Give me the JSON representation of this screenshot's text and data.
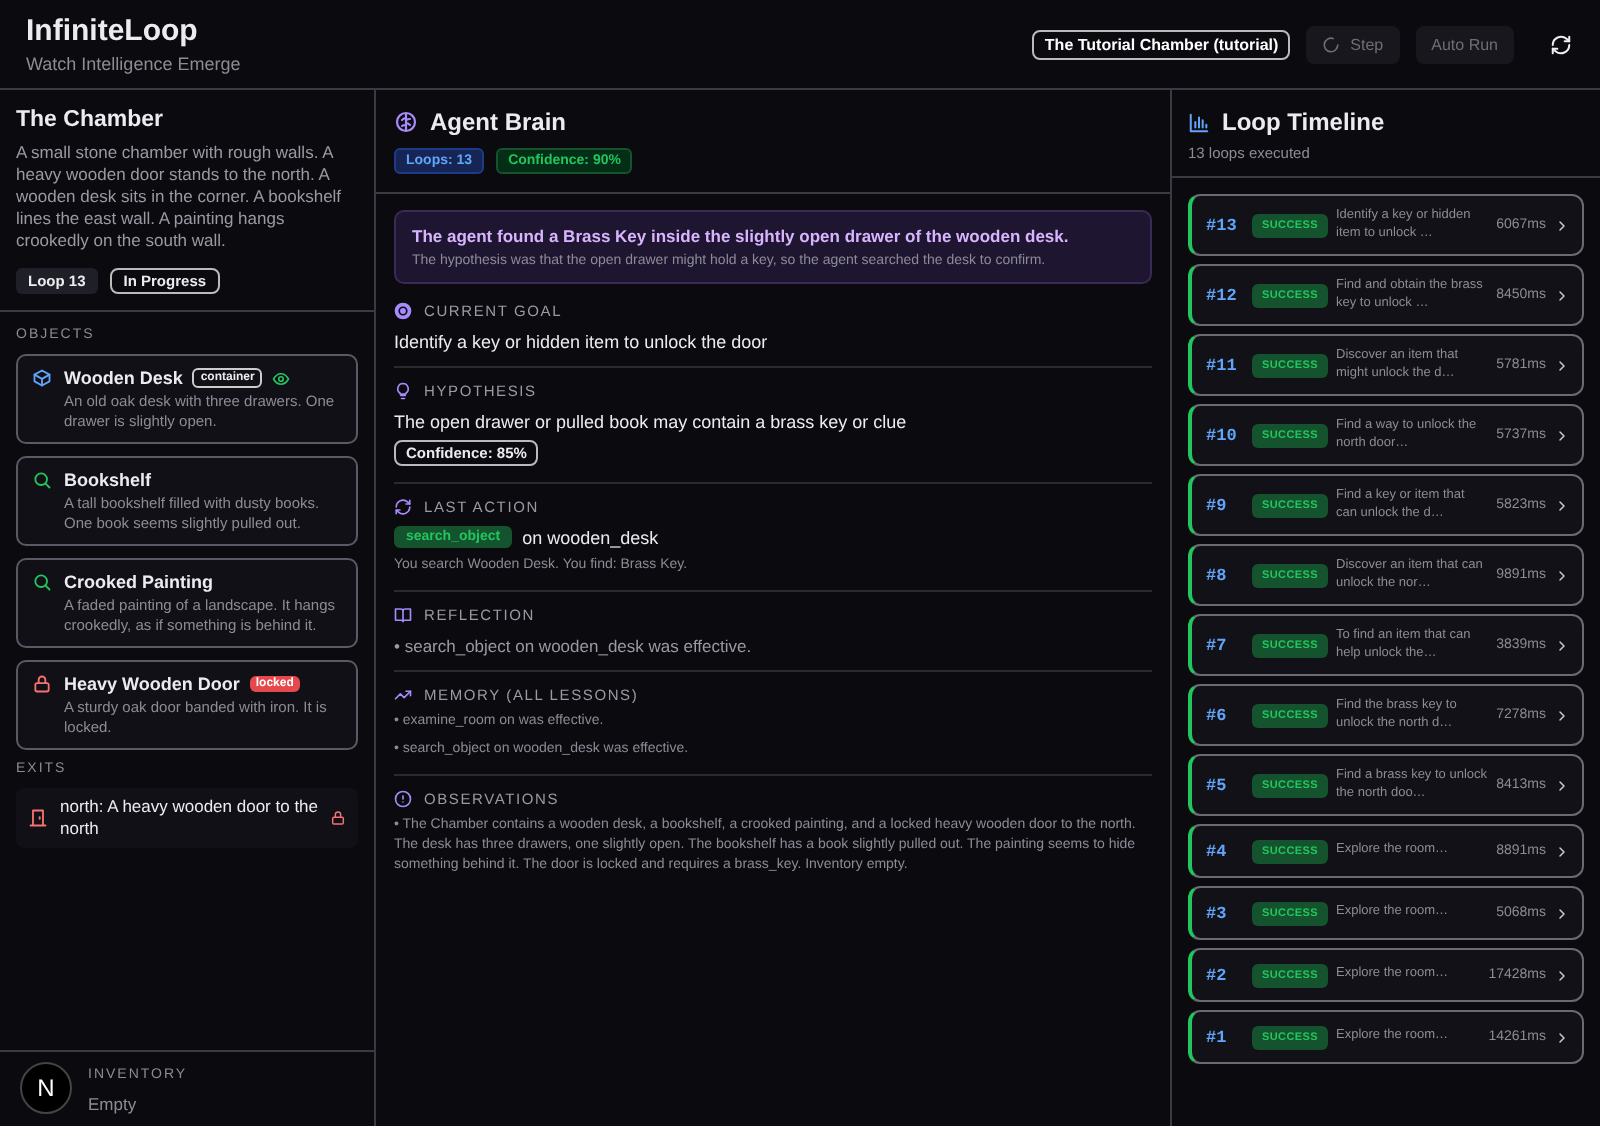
{
  "app": {
    "title": "InfiniteLoop",
    "subtitle": "Watch Intelligence Emerge"
  },
  "toolbar": {
    "scenario": "The Tutorial Chamber (tutorial)",
    "buttons": [
      {
        "kind": "spinner",
        "label": "Step",
        "disabled": true
      },
      {
        "kind": "plain",
        "label": "Auto Run",
        "disabled": true
      },
      {
        "kind": "refresh",
        "disabled": false
      }
    ]
  },
  "chamber": {
    "title": "The Chamber",
    "description": "A small stone chamber with rough walls. A heavy wooden door stands to the north. A wooden desk sits in the corner. A bookshelf lines the east wall. A painting hangs crookedly on the south wall.",
    "loop": "Loop 13",
    "status": "In Progress",
    "objects_heading": "OBJECTS",
    "objects": [
      {
        "kind": "container",
        "name": "Wooden Desk",
        "tag": {
          "text": "container",
          "kind": "outline"
        },
        "examined": true,
        "description": "An old oak desk with three drawers. One drawer is slightly open."
      },
      {
        "kind": "searchable",
        "name": "Bookshelf",
        "examined": false,
        "description": "A tall bookshelf filled with dusty books. One book seems slightly pulled out."
      },
      {
        "kind": "searchable",
        "name": "Crooked Painting",
        "examined": false,
        "description": "A faded painting of a landscape. It hangs crookedly, as if something is behind it."
      },
      {
        "kind": "locked",
        "name": "Heavy Wooden Door",
        "tag": {
          "text": "locked",
          "kind": "danger"
        },
        "examined": false,
        "description": "A sturdy oak door banded with iron. It is locked."
      }
    ],
    "exits_heading": "EXITS",
    "exits": [
      {
        "label": "north: A heavy wooden door to the north",
        "locked": true
      }
    ],
    "inventory": {
      "heading": "INVENTORY",
      "value": "Empty"
    }
  },
  "brain": {
    "title": "Agent Brain",
    "loops": "Loops: 13",
    "confidence": "Confidence: 90%",
    "insight": {
      "headline": "The agent found a Brass Key inside the slightly open drawer of the wooden desk.",
      "detail": "The hypothesis was that the open drawer might hold a key, so the agent searched the desk to confirm."
    },
    "sections": [
      {
        "kind": "goal",
        "heading": "CURRENT GOAL",
        "text": "Identify a key or hidden item to unlock the door"
      },
      {
        "kind": "hypothesis",
        "heading": "HYPOTHESIS",
        "text": "The open drawer or pulled book may contain a brass key or clue",
        "badge": "Confidence: 85%"
      },
      {
        "kind": "action",
        "heading": "LAST ACTION",
        "action": "search_object",
        "target": "on wooden_desk",
        "result": "You search Wooden Desk. You find: Brass Key."
      },
      {
        "kind": "reflection",
        "heading": "REFLECTION",
        "lines": [
          "• search_object on wooden_desk was effective."
        ]
      },
      {
        "kind": "memory",
        "heading": "MEMORY (ALL LESSONS)",
        "lines": [
          "• examine_room on was effective.",
          "• search_object on wooden_desk was effective."
        ]
      },
      {
        "kind": "observations",
        "heading": "OBSERVATIONS",
        "lines": [
          "• The Chamber contains a wooden desk, a bookshelf, a crooked painting, and a locked heavy wooden door to the north. The desk has three drawers, one slightly open. The bookshelf has a book slightly pulled out. The painting seems to hide something behind it. The door is locked and requires a brass_key. Inventory empty."
        ]
      }
    ]
  },
  "timeline": {
    "title": "Loop Timeline",
    "subtitle": "13 loops executed",
    "loops": [
      {
        "kind": "success",
        "number": "#13",
        "status": "SUCCESS",
        "goal": "Identify a key or hidden item to unlock …",
        "duration": "6067ms"
      },
      {
        "kind": "success",
        "number": "#12",
        "status": "SUCCESS",
        "goal": "Find and obtain the brass key to unlock …",
        "duration": "8450ms"
      },
      {
        "kind": "success",
        "number": "#11",
        "status": "SUCCESS",
        "goal": "Discover an item that might unlock the d…",
        "duration": "5781ms"
      },
      {
        "kind": "success",
        "number": "#10",
        "status": "SUCCESS",
        "goal": "Find a way to unlock the north door…",
        "duration": "5737ms"
      },
      {
        "kind": "success",
        "number": "#9",
        "status": "SUCCESS",
        "goal": "Find a key or item that can unlock the d…",
        "duration": "5823ms"
      },
      {
        "kind": "success",
        "number": "#8",
        "status": "SUCCESS",
        "goal": "Discover an item that can unlock the nor…",
        "duration": "9891ms"
      },
      {
        "kind": "success",
        "number": "#7",
        "status": "SUCCESS",
        "goal": "To find an item that can help unlock the…",
        "duration": "3839ms"
      },
      {
        "kind": "success",
        "number": "#6",
        "status": "SUCCESS",
        "goal": "Find the brass key to unlock the north d…",
        "duration": "7278ms"
      },
      {
        "kind": "success",
        "number": "#5",
        "status": "SUCCESS",
        "goal": "Find a brass key to unlock the north doo…",
        "duration": "8413ms"
      },
      {
        "kind": "success",
        "number": "#4",
        "status": "SUCCESS",
        "goal": "Explore the room…",
        "duration": "8891ms"
      },
      {
        "kind": "success",
        "number": "#3",
        "status": "SUCCESS",
        "goal": "Explore the room…",
        "duration": "5068ms"
      },
      {
        "kind": "success",
        "number": "#2",
        "status": "SUCCESS",
        "goal": "Explore the room…",
        "duration": "17428ms"
      },
      {
        "kind": "success",
        "number": "#1",
        "status": "SUCCESS",
        "goal": "Explore the room…",
        "duration": "14261ms"
      }
    ]
  },
  "dev_badge": {
    "label": "N"
  }
}
